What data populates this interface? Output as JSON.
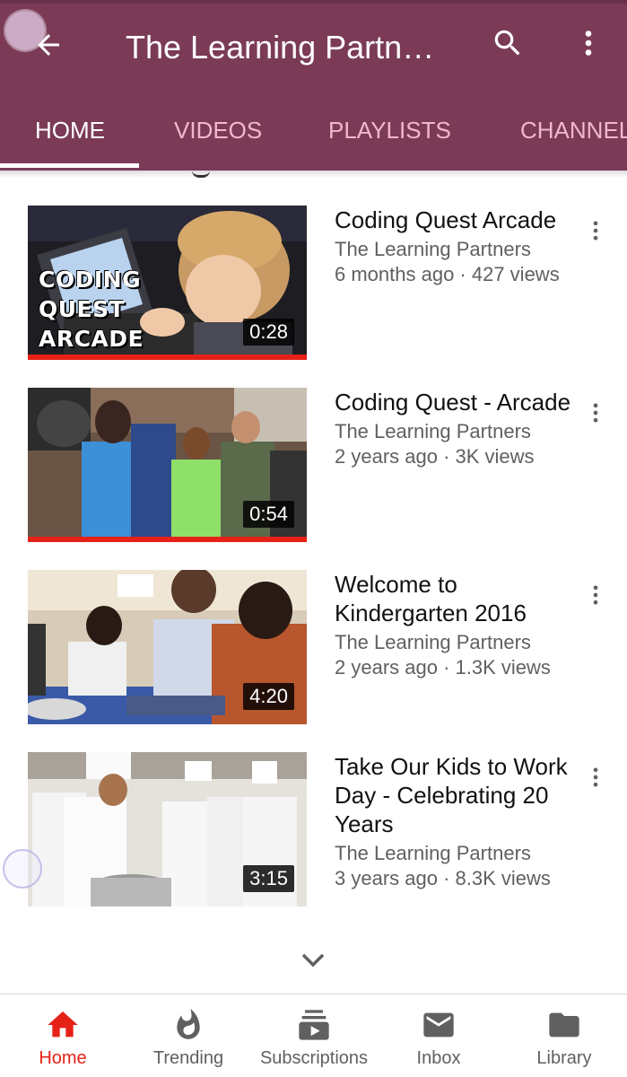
{
  "app_bar": {
    "title": "The Learning Partners",
    "back_icon": "arrow-back-icon",
    "search_icon": "search-icon",
    "overflow_icon": "more-vert-icon",
    "color": "#7b3b57"
  },
  "tabs": [
    {
      "label": "HOME",
      "active": true
    },
    {
      "label": "VIDEOS",
      "active": false
    },
    {
      "label": "PLAYLISTS",
      "active": false
    },
    {
      "label": "CHANNELS",
      "active": false
    }
  ],
  "videos": [
    {
      "title": "Coding Quest Arcade",
      "channel": "The Learning Partners",
      "age_views": "6 months ago · 427 views",
      "duration": "0:28",
      "watched": true,
      "thumb_caption": [
        "CODING",
        "QUEST",
        "ARCADE"
      ]
    },
    {
      "title": "Coding Quest - Arcade",
      "channel": "The Learning Partners",
      "age_views": "2 years ago · 3K views",
      "duration": "0:54",
      "watched": true
    },
    {
      "title": "Welcome to Kindergarten 2016",
      "channel": "The Learning Partners",
      "age_views": "2 years ago · 1.3K views",
      "duration": "4:20",
      "watched": false
    },
    {
      "title": "Take Our Kids to Work Day - Celebrating 20 Years",
      "channel": "The Learning Partners",
      "age_views": "3 years ago · 8.3K views",
      "duration": "3:15",
      "watched": false
    }
  ],
  "bottom_nav": [
    {
      "label": "Home",
      "icon": "home-icon",
      "active": true
    },
    {
      "label": "Trending",
      "icon": "flame-icon",
      "active": false
    },
    {
      "label": "Subscriptions",
      "icon": "subscriptions-icon",
      "active": false
    },
    {
      "label": "Inbox",
      "icon": "mail-icon",
      "active": false
    },
    {
      "label": "Library",
      "icon": "folder-icon",
      "active": false
    }
  ],
  "colors": {
    "accent": "#e62117",
    "tab_inactive": "#f1b7cf"
  }
}
